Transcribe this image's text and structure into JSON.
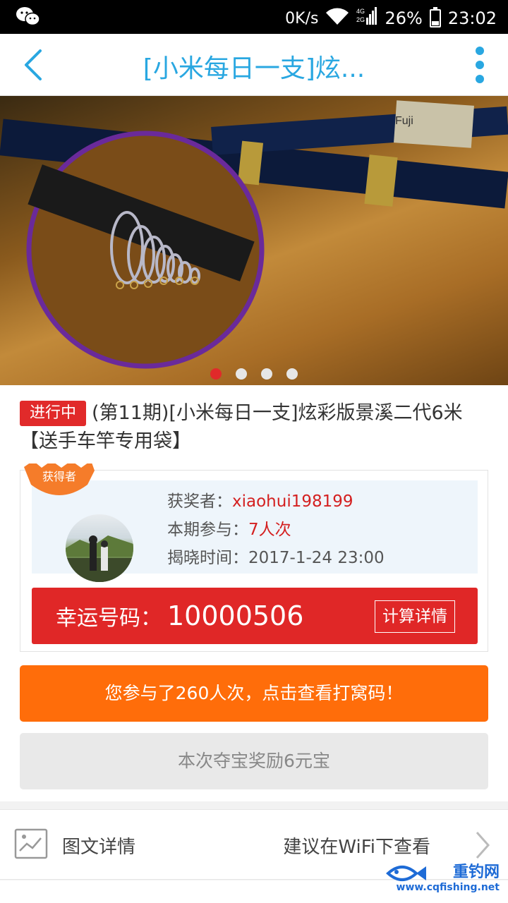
{
  "status_bar": {
    "network_speed": "0K/s",
    "network_type": "4G 2G",
    "battery": "26%",
    "battery_level": 0.26,
    "time": "23:02",
    "left_icon": "wechat-icon"
  },
  "header": {
    "title": "[小米每日一支]炫...",
    "back_icon": "back-arrow-icon",
    "more_icon": "more-vertical-icon",
    "accent_color": "#29a7e1"
  },
  "banner": {
    "slide_count": 4,
    "active_slide": 1,
    "rod_label": "Fuji"
  },
  "product": {
    "status_badge": "进行中",
    "title": "(第11期)[小米每日一支]炫彩版景溪二代6米【送手车竿专用袋】"
  },
  "winner": {
    "ribbon": "获得者",
    "winner_label": "获奖者：",
    "winner_name": "xiaohui198199",
    "participate_label": "本期参与：",
    "participate_count": "7人次",
    "reveal_label": "揭晓时间：",
    "reveal_time": "2017-1-24 23:00",
    "lucky_label": "幸运号码：",
    "lucky_number": "10000506",
    "calc_button": "计算详情"
  },
  "actions": {
    "participation_button": "您参与了260人次，点击查看打窝码！",
    "reward_text": "本次夺宝奖励6元宝"
  },
  "detail": {
    "label": "图文详情",
    "hint": "建议在WiFi下查看",
    "icon": "image-icon"
  },
  "watermark": {
    "text": "重钓网",
    "url": "www.cqfishing.net"
  }
}
